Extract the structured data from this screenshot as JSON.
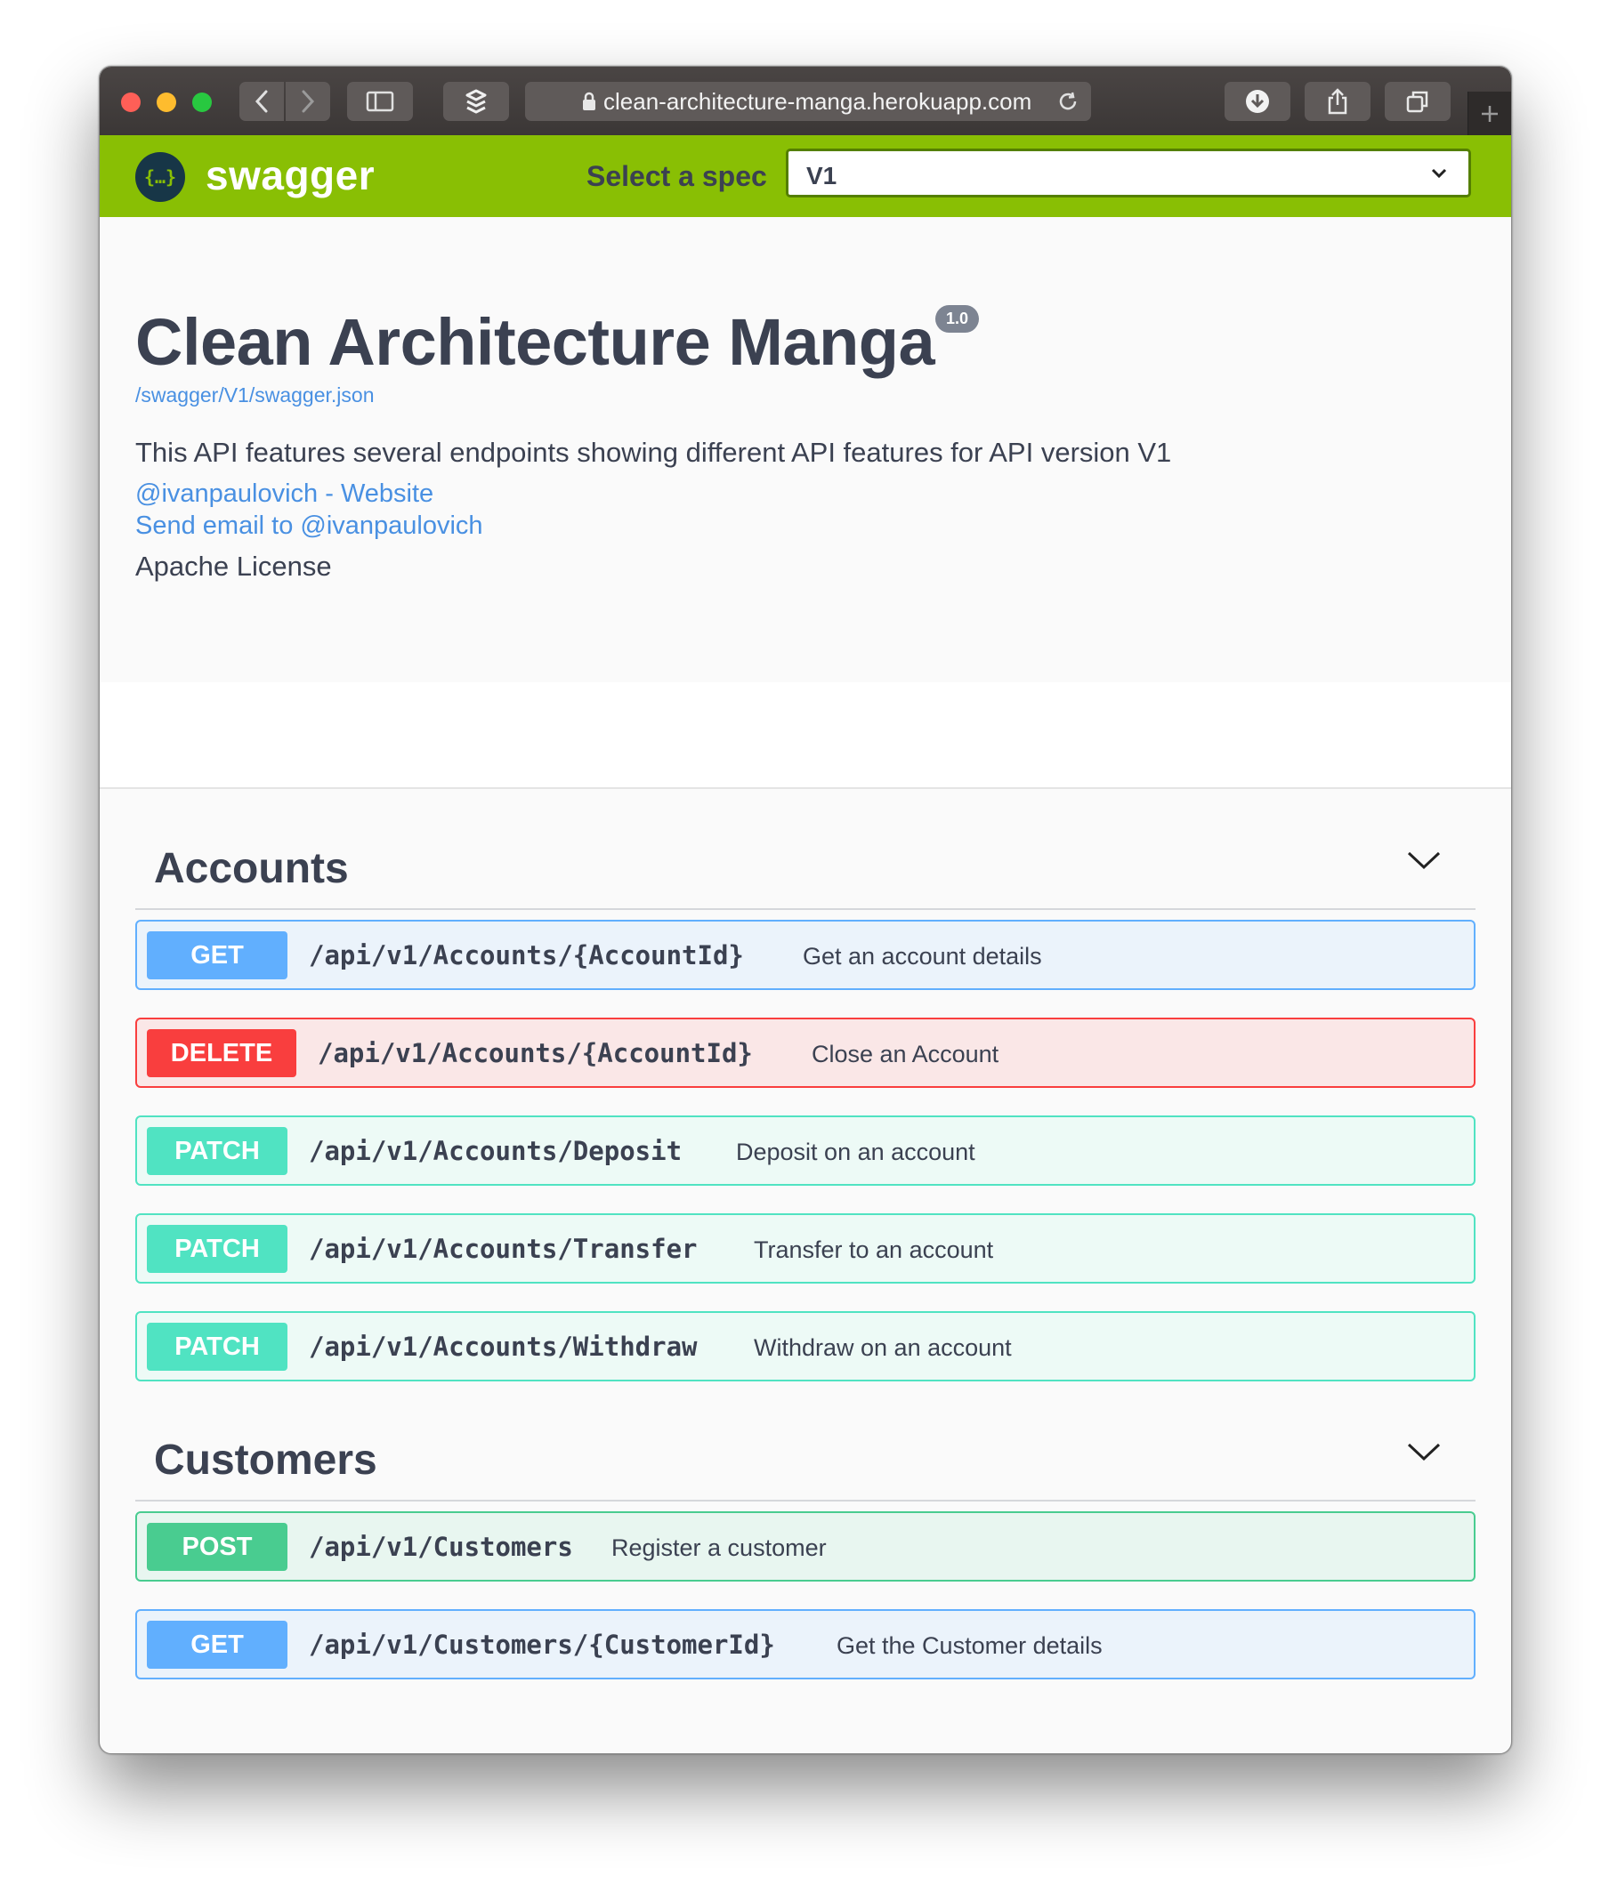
{
  "browser": {
    "url": "clean-architecture-manga.herokuapp.com",
    "icons": [
      "back-icon",
      "forward-icon",
      "sidebar-icon",
      "extension-icon",
      "lock-icon",
      "reload-icon",
      "download-icon",
      "share-icon",
      "tabs-icon",
      "new-tab-icon"
    ]
  },
  "topbar": {
    "logo_text": "swagger",
    "logo_symbol": "{…}",
    "spec_label": "Select a spec",
    "spec_value": "V1",
    "color": "#89bf04"
  },
  "info": {
    "title": "Clean Architecture Manga",
    "version": "1.0",
    "spec_url": "/swagger/V1/swagger.json",
    "description": "This API features several endpoints showing different API features for API version V1",
    "contact_link": "@ivanpaulovich - Website",
    "email_link": "Send email to @ivanpaulovich",
    "license": "Apache License"
  },
  "tags": [
    {
      "name": "Accounts",
      "operations": [
        {
          "method": "GET",
          "path": "/api/v1/Accounts/{AccountId}",
          "summary": "Get an account details"
        },
        {
          "method": "DELETE",
          "path": "/api/v1/Accounts/{AccountId}",
          "summary": "Close an Account"
        },
        {
          "method": "PATCH",
          "path": "/api/v1/Accounts/Deposit",
          "summary": "Deposit on an account"
        },
        {
          "method": "PATCH",
          "path": "/api/v1/Accounts/Transfer",
          "summary": "Transfer to an account"
        },
        {
          "method": "PATCH",
          "path": "/api/v1/Accounts/Withdraw",
          "summary": "Withdraw on an account"
        }
      ]
    },
    {
      "name": "Customers",
      "operations": [
        {
          "method": "POST",
          "path": "/api/v1/Customers",
          "summary": "Register a customer"
        },
        {
          "method": "GET",
          "path": "/api/v1/Customers/{CustomerId}",
          "summary": "Get the Customer details"
        }
      ]
    }
  ],
  "method_colors": {
    "GET": "#61affe",
    "DELETE": "#f93e3e",
    "PATCH": "#50e3c2",
    "POST": "#49cc90"
  }
}
